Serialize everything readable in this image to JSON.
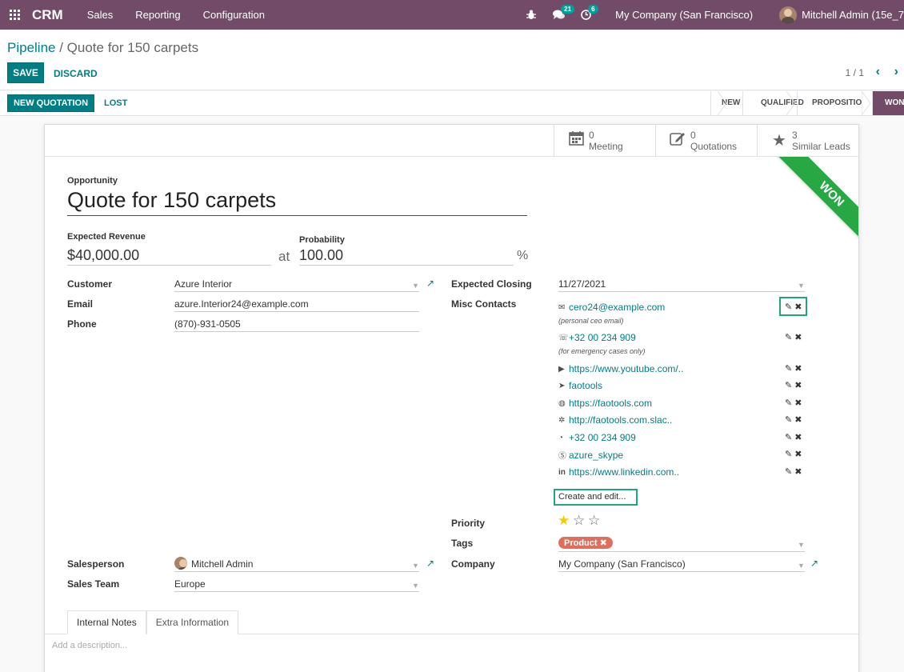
{
  "navbar": {
    "brand": "CRM",
    "menu": [
      "Sales",
      "Reporting",
      "Configuration"
    ],
    "chat_badge": "21",
    "activity_badge": "6",
    "company": "My Company (San Francisco)",
    "user": "Mitchell Admin (15e_7"
  },
  "breadcrumb": {
    "parent": "Pipeline",
    "separator": " / ",
    "current": "Quote for 150 carpets"
  },
  "actions": {
    "save": "SAVE",
    "discard": "DISCARD",
    "pager": "1 / 1",
    "new_quotation": "NEW QUOTATION",
    "lost": "LOST"
  },
  "stages": [
    "NEW",
    "QUALIFIED",
    "PROPOSITION",
    "WON"
  ],
  "active_stage": "WON",
  "stat_buttons": [
    {
      "value": "0",
      "label": "Meeting",
      "icon": "calendar-icon"
    },
    {
      "value": "0",
      "label": "Quotations",
      "icon": "edit-icon"
    },
    {
      "value": "3",
      "label": "Similar Leads",
      "icon": "star-icon"
    }
  ],
  "ribbon": "WON",
  "form": {
    "opportunity_label": "Opportunity",
    "title": "Quote for 150 carpets",
    "expected_revenue_label": "Expected Revenue",
    "expected_revenue": "$40,000.00",
    "at": "at",
    "probability_label": "Probability",
    "probability": "100.00",
    "percent": "%",
    "customer_label": "Customer",
    "customer": "Azure Interior",
    "email_label": "Email",
    "email": "azure.Interior24@example.com",
    "phone_label": "Phone",
    "phone": "(870)-931-0505",
    "expected_closing_label": "Expected Closing",
    "expected_closing": "11/27/2021",
    "misc_contacts_label": "Misc Contacts",
    "priority_label": "Priority",
    "priority_value": 1,
    "priority_max": 3,
    "tags_label": "Tags",
    "tag": "Product",
    "tag_color": "#e16e5b",
    "salesperson_label": "Salesperson",
    "salesperson": "Mitchell Admin",
    "sales_team_label": "Sales Team",
    "sales_team": "Europe",
    "company_label": "Company",
    "company": "My Company (San Francisco)",
    "create_and_edit": "Create and edit..."
  },
  "misc_contacts": [
    {
      "icon": "envelope-icon",
      "glyph": "✉",
      "text": "cero24@example.com",
      "note": "(personal ceo email)"
    },
    {
      "icon": "phone-icon",
      "glyph": "☏",
      "text": "+32 00 234 909",
      "note": "(for emergency cases only)"
    },
    {
      "icon": "youtube-icon",
      "glyph": "▶",
      "text": "https://www.youtube.com/..",
      "note": ""
    },
    {
      "icon": "telegram-icon",
      "glyph": "➤",
      "text": "faotools",
      "note": ""
    },
    {
      "icon": "globe-icon",
      "glyph": "◍",
      "text": "https://faotools.com",
      "note": ""
    },
    {
      "icon": "slack-icon",
      "glyph": "✲",
      "text": "http://faotools.com.slac..",
      "note": ""
    },
    {
      "icon": "whatsapp-icon",
      "glyph": "◔",
      "text": "+32 00 234 909",
      "note": ""
    },
    {
      "icon": "skype-icon",
      "glyph": "Ⓢ",
      "text": "azure_skype",
      "note": ""
    },
    {
      "icon": "linkedin-icon",
      "glyph": "in",
      "text": "https://www.linkedin.com..",
      "note": ""
    }
  ],
  "tabs": [
    "Internal Notes",
    "Extra Information"
  ],
  "description_placeholder": "Add a description...",
  "colors": {
    "navbar": "#714b67",
    "primary": "#017e84",
    "won_ribbon": "#28a745",
    "highlight": "#1ea680"
  }
}
